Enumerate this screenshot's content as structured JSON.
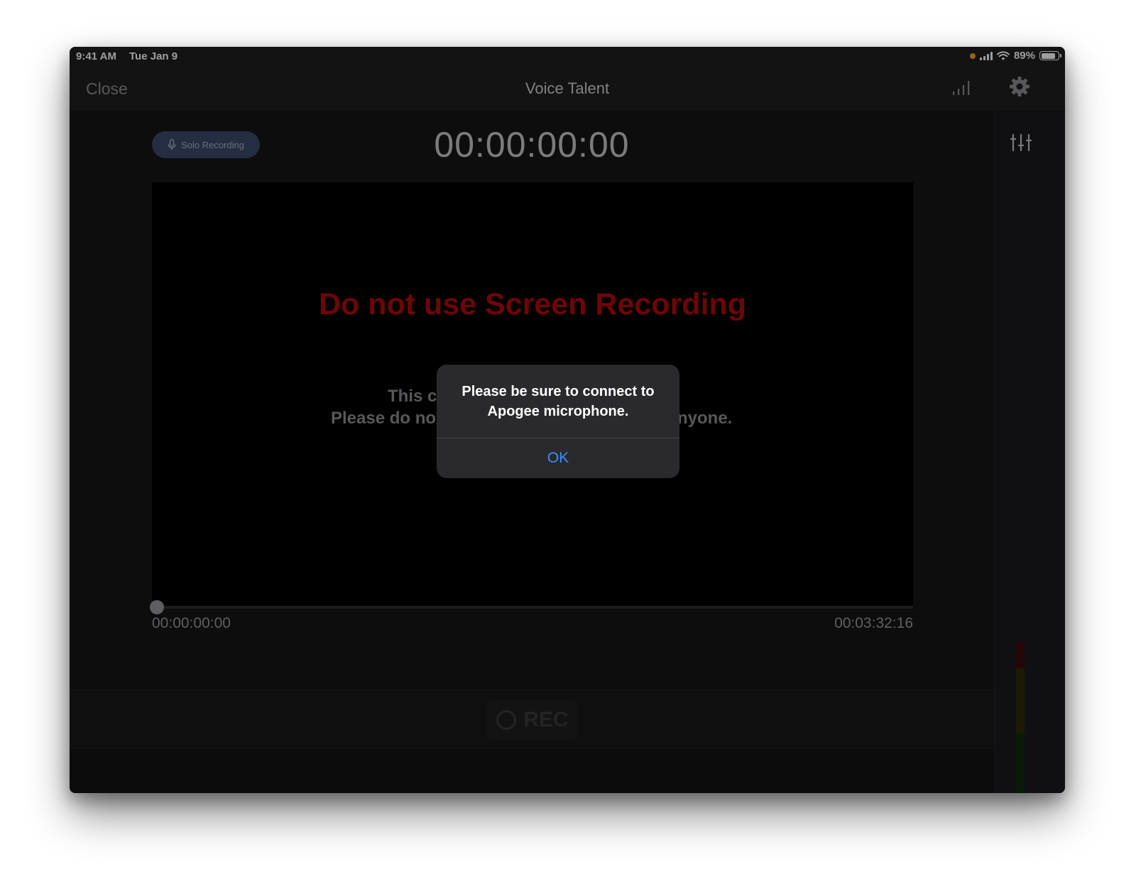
{
  "status_bar": {
    "time": "9:41 AM",
    "date": "Tue Jan 9",
    "battery": "89%",
    "battery_level": 0.89
  },
  "nav": {
    "close_label": "Close",
    "title": "Voice Talent"
  },
  "recording": {
    "mode_label": "Solo Recording",
    "timecode": "00:00:00:00",
    "warning": "Do not use Screen Recording",
    "sub_line1_left": "This c",
    "sub_line2_left": "Please do no",
    "sub_line2_right": "nyone.",
    "progress": 0,
    "time_start": "00:00:00:00",
    "time_end": "00:03:32:16",
    "rec_label": "REC"
  },
  "alert": {
    "message": "Please be sure to connect to Apogee microphone.",
    "ok_label": "OK"
  },
  "colors": {
    "warning": "#b00a0a",
    "link": "#3e8ef7",
    "solo_button": "#3a4a6b"
  }
}
